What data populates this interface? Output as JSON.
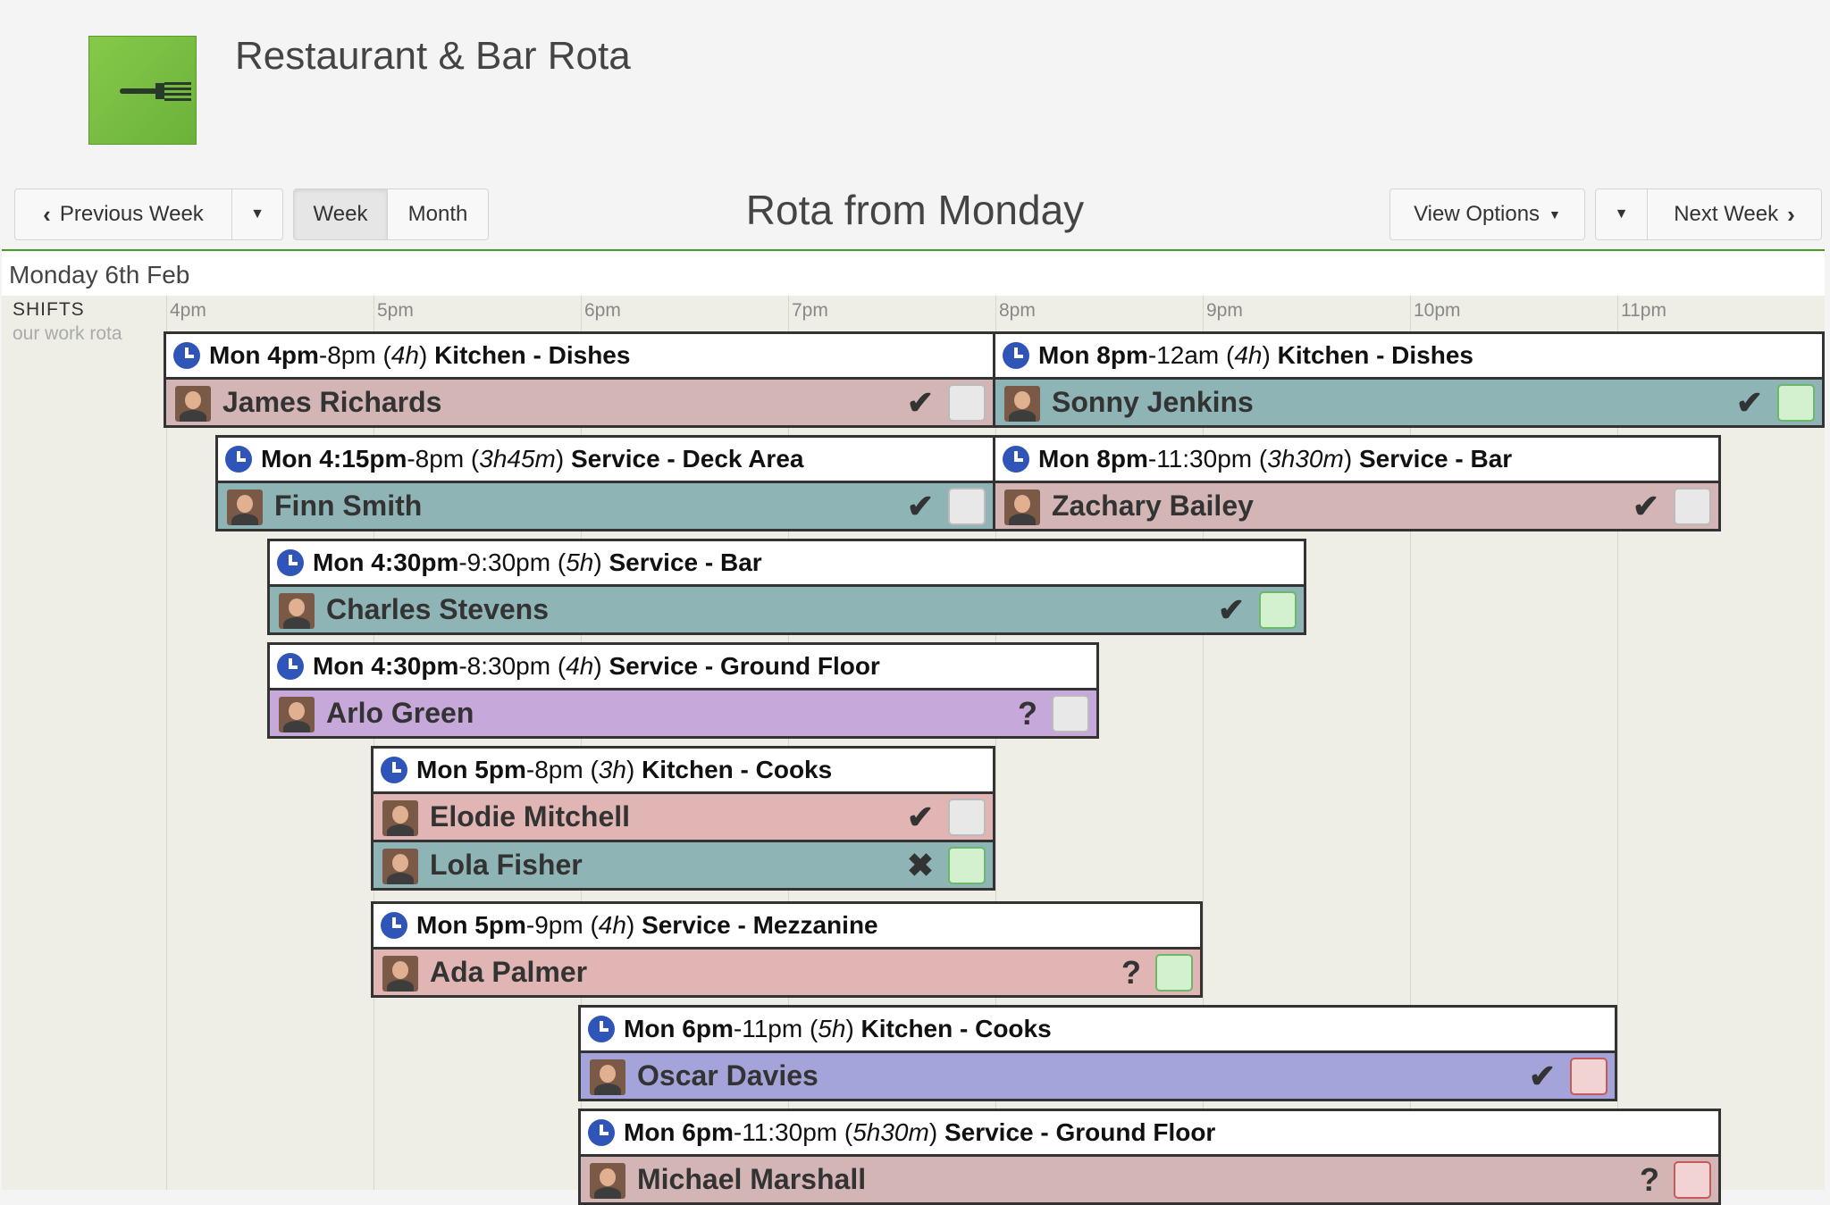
{
  "header": {
    "app_title": "Restaurant & Bar Rota",
    "logo_icon": "fork-icon"
  },
  "toolbar": {
    "previous_week": "Previous Week",
    "week": "Week",
    "month": "Month",
    "rota_title": "Rota from Monday",
    "view_options": "View Options",
    "next_week": "Next Week",
    "active_view": "Week"
  },
  "day": {
    "label": "Monday 6th Feb",
    "shifts_title": "SHIFTS",
    "shifts_sub": "our work rota"
  },
  "hours": [
    "4pm",
    "5pm",
    "6pm",
    "7pm",
    "8pm",
    "9pm",
    "10pm",
    "11pm"
  ],
  "colors": {
    "pink": "#d3b5b5",
    "teal": "#8fb4b5",
    "purple": "#c6a8db",
    "salmon": "#e1b5b3",
    "violet": "#a4a4da",
    "accent_green": "#4a9a2c",
    "clock_blue": "#2f55b8"
  },
  "shifts": [
    {
      "start_b": "Mon 4pm",
      "rest": "-8pm (",
      "dur": "4h",
      "rest2": ") ",
      "role": "Kitchen - Dishes",
      "people": [
        {
          "name": "James Richards",
          "mark": "✔",
          "box": "grey",
          "color": "pink"
        }
      ]
    },
    {
      "start_b": "Mon 8pm",
      "rest": "-12am (",
      "dur": "4h",
      "rest2": ") ",
      "role": "Kitchen - Dishes",
      "people": [
        {
          "name": "Sonny Jenkins",
          "mark": "✔",
          "box": "green",
          "color": "teal"
        }
      ]
    },
    {
      "start_b": "Mon 4:15pm",
      "rest": "-8pm (",
      "dur": "3h45m",
      "rest2": ") ",
      "role": "Service - Deck Area",
      "people": [
        {
          "name": "Finn Smith",
          "mark": "✔",
          "box": "grey",
          "color": "teal"
        }
      ]
    },
    {
      "start_b": "Mon 8pm",
      "rest": "-11:30pm (",
      "dur": "3h30m",
      "rest2": ") ",
      "role": "Service - Bar",
      "people": [
        {
          "name": "Zachary Bailey",
          "mark": "✔",
          "box": "grey",
          "color": "pink"
        }
      ]
    },
    {
      "start_b": "Mon 4:30pm",
      "rest": "-9:30pm (",
      "dur": "5h",
      "rest2": ") ",
      "role": "Service - Bar",
      "people": [
        {
          "name": "Charles Stevens",
          "mark": "✔",
          "box": "green",
          "color": "teal"
        }
      ]
    },
    {
      "start_b": "Mon 4:30pm",
      "rest": "-8:30pm (",
      "dur": "4h",
      "rest2": ") ",
      "role": "Service - Ground Floor",
      "people": [
        {
          "name": "Arlo Green",
          "mark": "?",
          "box": "grey",
          "color": "purple"
        }
      ]
    },
    {
      "start_b": "Mon 5pm",
      "rest": "-8pm (",
      "dur": "3h",
      "rest2": ") ",
      "role": "Kitchen - Cooks",
      "people": [
        {
          "name": "Elodie Mitchell",
          "mark": "✔",
          "box": "grey",
          "color": "salmon"
        },
        {
          "name": "Lola Fisher",
          "mark": "✖",
          "box": "green",
          "color": "teal"
        }
      ]
    },
    {
      "start_b": "Mon 5pm",
      "rest": "-9pm (",
      "dur": "4h",
      "rest2": ") ",
      "role": "Service - Mezzanine",
      "people": [
        {
          "name": "Ada Palmer",
          "mark": "?",
          "box": "green",
          "color": "salmon"
        }
      ]
    },
    {
      "start_b": "Mon 6pm",
      "rest": "-11pm (",
      "dur": "5h",
      "rest2": ") ",
      "role": "Kitchen - Cooks",
      "people": [
        {
          "name": "Oscar Davies",
          "mark": "✔",
          "box": "red",
          "color": "violet"
        }
      ]
    },
    {
      "start_b": "Mon 6pm",
      "rest": "-11:30pm (",
      "dur": "5h30m",
      "rest2": ") ",
      "role": "Service - Ground Floor",
      "people": [
        {
          "name": "Michael Marshall",
          "mark": "?",
          "box": "red",
          "color": "pink"
        }
      ]
    }
  ]
}
